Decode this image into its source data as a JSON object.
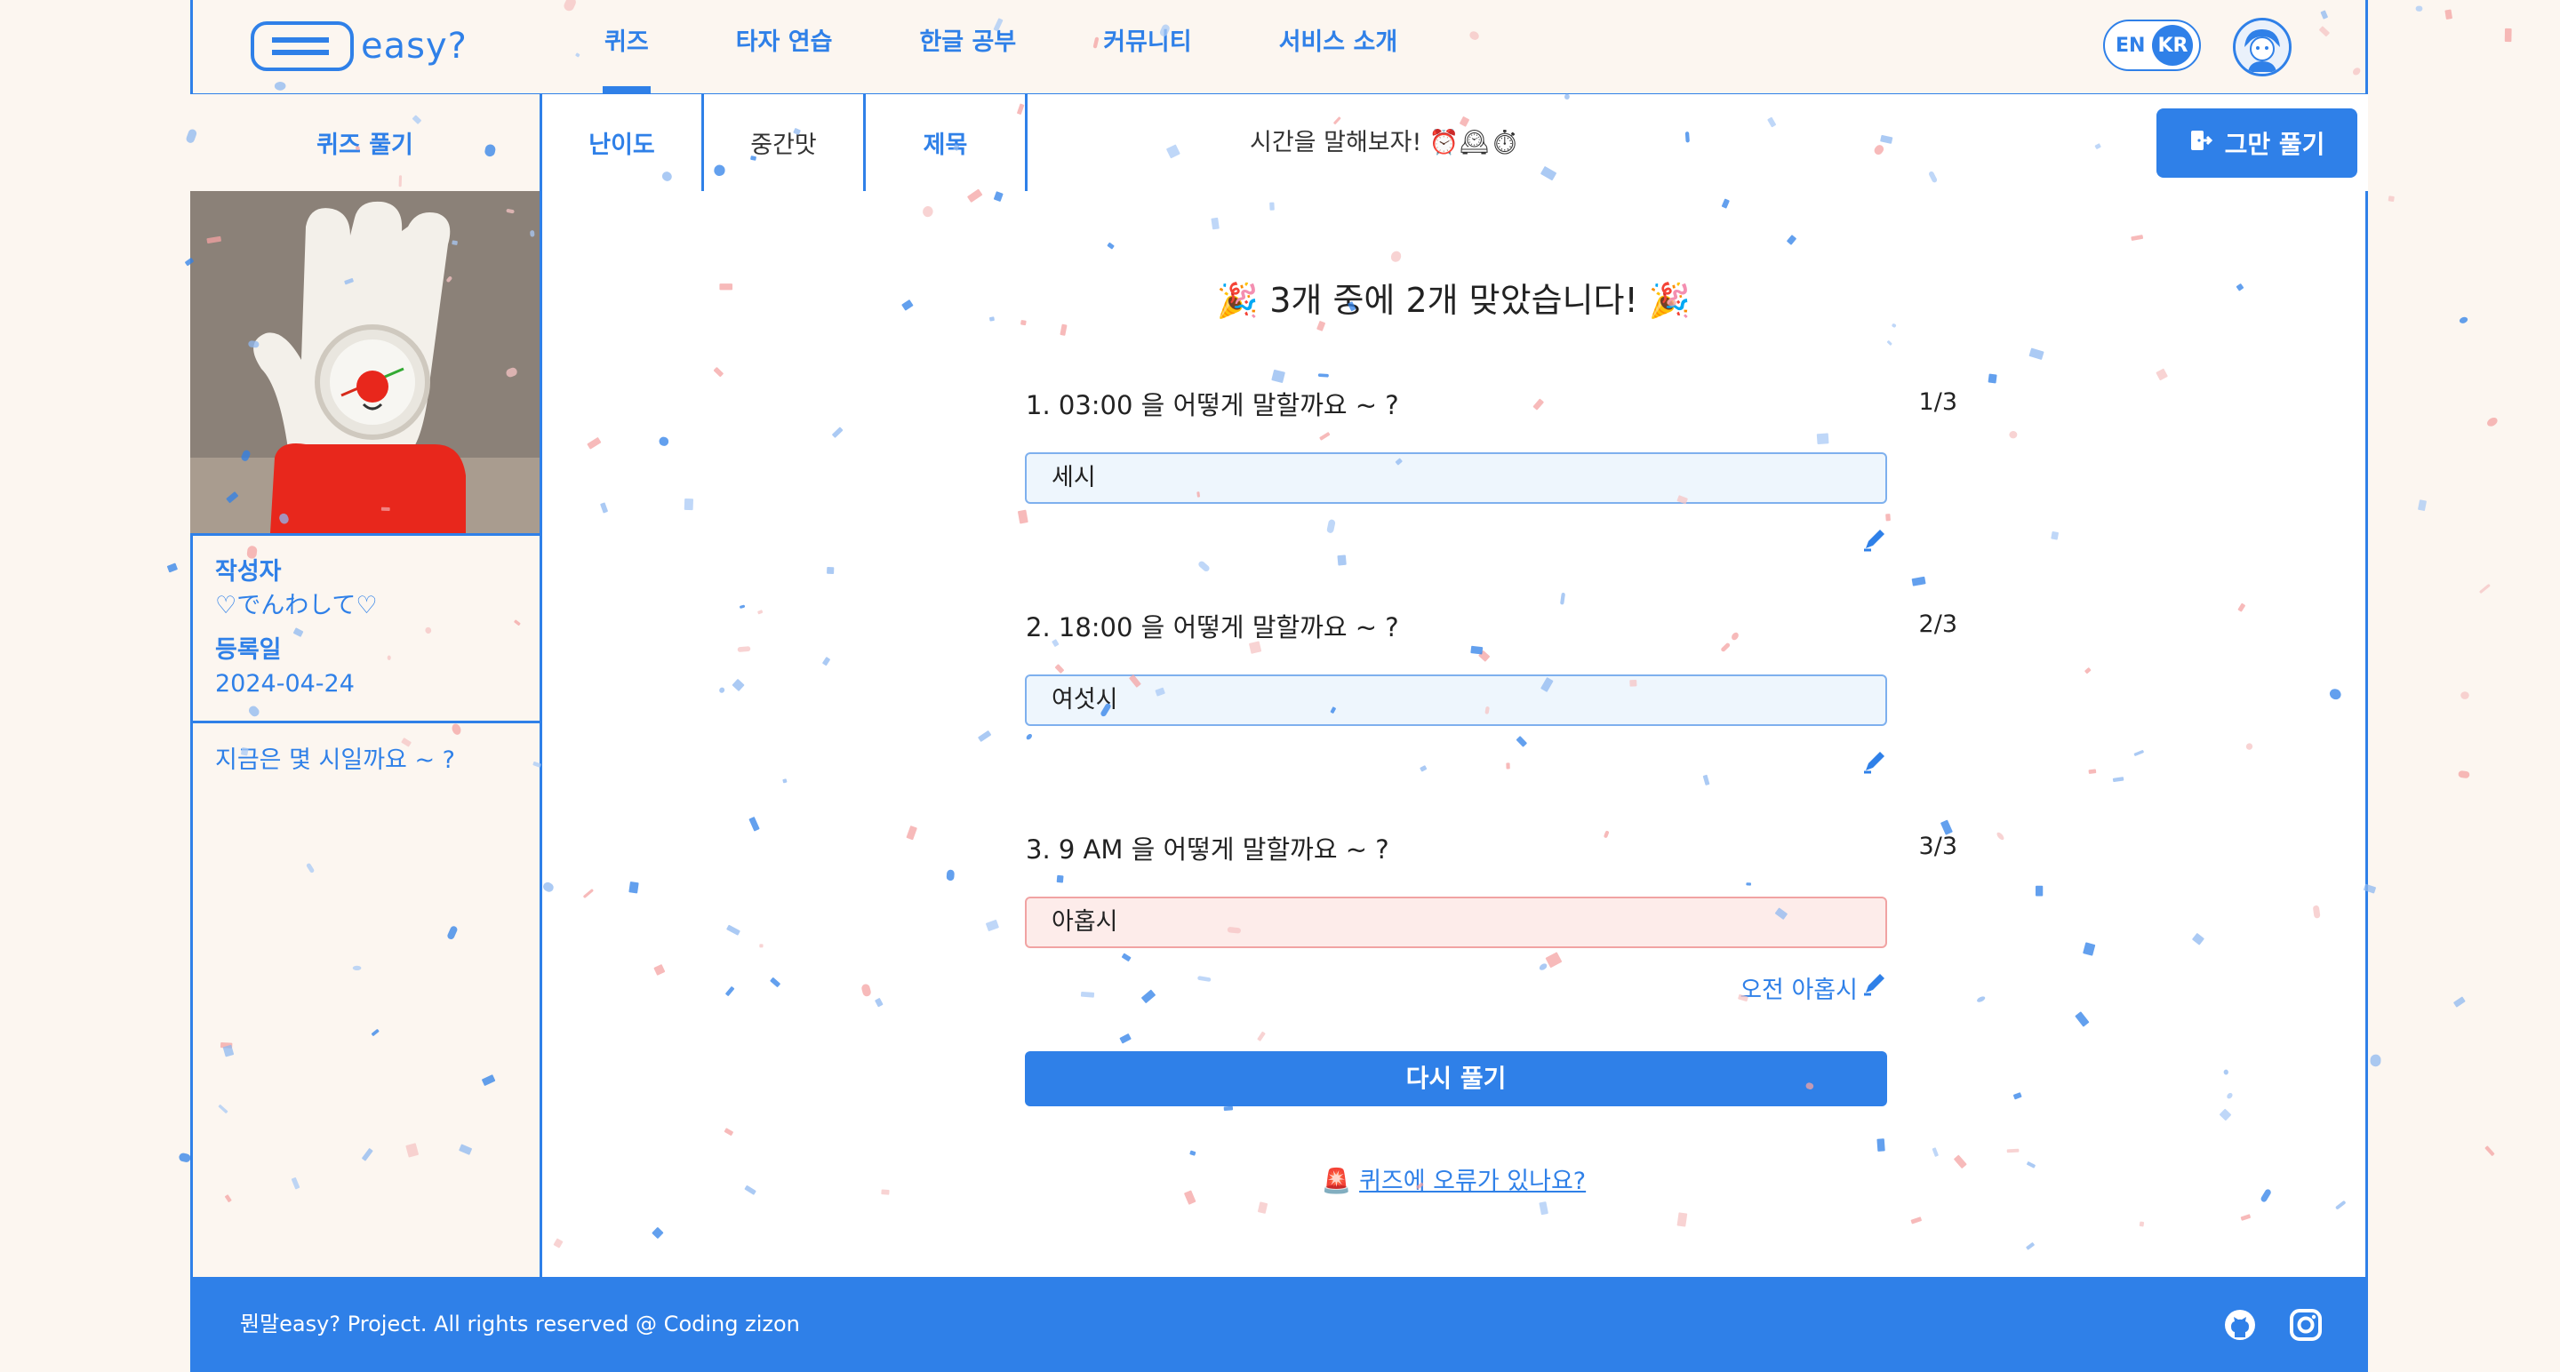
{
  "brand": {
    "logo_text": "easy?",
    "primary_color": "#2f80e8",
    "background_color": "#fcf6f0"
  },
  "nav": {
    "items": [
      {
        "label": "퀴즈",
        "active": true
      },
      {
        "label": "타자 연습",
        "active": false
      },
      {
        "label": "한글 공부",
        "active": false
      },
      {
        "label": "커뮤니티",
        "active": false
      },
      {
        "label": "서비스 소개",
        "active": false
      }
    ],
    "lang_en": "EN",
    "lang_kr": "KR"
  },
  "quizbar": {
    "section_label": "퀴즈 풀기",
    "difficulty_label": "난이도",
    "difficulty_value": "중간맛",
    "title_label": "제목",
    "title_value": "시간을 말해보자! ⏰🕰⏱",
    "quit_label": "그만 풀기"
  },
  "sidebar": {
    "author_label": "작성자",
    "author_value": "♡でんわして♡",
    "date_label": "등록일",
    "date_value": "2024-04-24",
    "description": "지금은 몇 시일까요 ~ ?"
  },
  "result": {
    "title": "🎉 3개 중에 2개 맞았습니다! 🎉",
    "questions": [
      {
        "text": "1. 03:00 을 어떻게 말할까요 ~ ?",
        "count": "1/3",
        "answer": "세시",
        "correct": true
      },
      {
        "text": "2. 18:00 을 어떻게 말할까요 ~ ?",
        "count": "2/3",
        "answer": "여섯시",
        "correct": true
      },
      {
        "text": "3. 9 AM 을 어떻게 말할까요 ~ ?",
        "count": "3/3",
        "answer": "아홉시",
        "correct": false,
        "correct_answer": "오전 아홉시"
      }
    ],
    "retry_label": "다시 풀기",
    "report_icon": "🚨",
    "report_label": "퀴즈에 오류가 있나요?"
  },
  "footer": {
    "text": "뭔말easy? Project. All rights reserved @ Coding zizon",
    "icons": [
      "github-icon",
      "instagram-icon"
    ]
  }
}
